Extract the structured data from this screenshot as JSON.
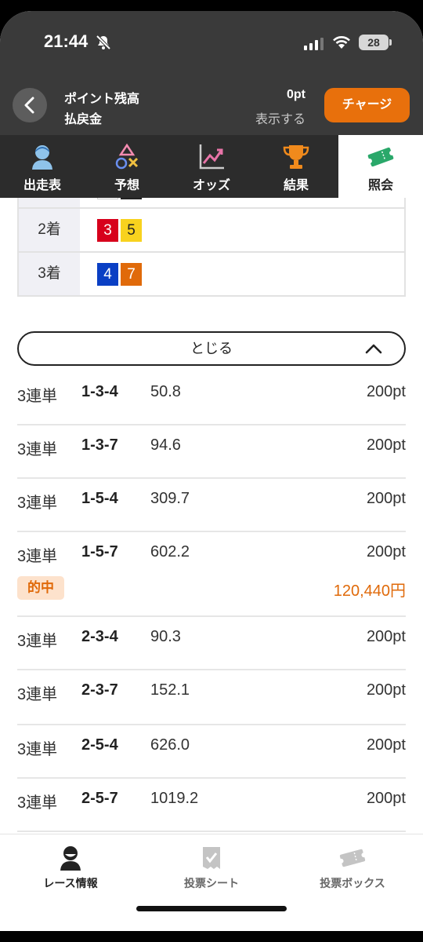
{
  "status": {
    "time": "21:44",
    "battery": "28"
  },
  "header": {
    "balance_label": "ポイント残高",
    "refund_label": "払戻金",
    "balance_value": "0pt",
    "show_label": "表示する",
    "charge_label": "チャージ"
  },
  "tabs": [
    {
      "label": "出走表",
      "icon": "racer-icon"
    },
    {
      "label": "予想",
      "icon": "prediction-icon"
    },
    {
      "label": "オッズ",
      "icon": "odds-chart-icon"
    },
    {
      "label": "結果",
      "icon": "trophy-icon"
    },
    {
      "label": "照会",
      "icon": "ticket-icon",
      "active": true
    }
  ],
  "result": {
    "rows": [
      {
        "place": "2着",
        "numbers": [
          "3",
          "5"
        ]
      },
      {
        "place": "3着",
        "numbers": [
          "4",
          "7"
        ]
      }
    ],
    "colors": {
      "1": "#ffffff",
      "2": "#222222",
      "3": "#d7001c",
      "4": "#0a3fc4",
      "5": "#f8d21e",
      "6": "#1e8a3c",
      "7": "#e06a0a"
    }
  },
  "close_label": "とじる",
  "bets": [
    {
      "type": "3連単",
      "combo": "1-3-4",
      "odds": "50.8",
      "amount": "200pt"
    },
    {
      "type": "3連単",
      "combo": "1-3-7",
      "odds": "94.6",
      "amount": "200pt"
    },
    {
      "type": "3連単",
      "combo": "1-5-4",
      "odds": "309.7",
      "amount": "200pt"
    },
    {
      "type": "3連単",
      "combo": "1-5-7",
      "odds": "602.2",
      "amount": "200pt",
      "hit_label": "的中",
      "payout": "120,440円"
    },
    {
      "type": "3連単",
      "combo": "2-3-4",
      "odds": "90.3",
      "amount": "200pt"
    },
    {
      "type": "3連単",
      "combo": "2-3-7",
      "odds": "152.1",
      "amount": "200pt"
    },
    {
      "type": "3連単",
      "combo": "2-5-4",
      "odds": "626.0",
      "amount": "200pt"
    },
    {
      "type": "3連単",
      "combo": "2-5-7",
      "odds": "1019.2",
      "amount": "200pt"
    }
  ],
  "bottom_nav": [
    {
      "label": "レース情報",
      "icon": "race-info-icon",
      "active": true
    },
    {
      "label": "投票シート",
      "icon": "vote-sheet-icon"
    },
    {
      "label": "投票ボックス",
      "icon": "vote-box-icon"
    }
  ]
}
